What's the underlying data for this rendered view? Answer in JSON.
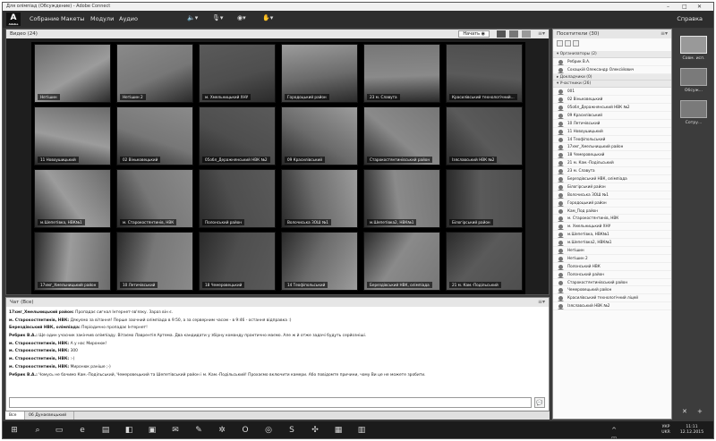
{
  "window": {
    "title": "Для олімпіад (Обсуждение) - Adobe Connect",
    "controls": [
      "–",
      "□",
      "✕"
    ]
  },
  "menubar": {
    "logo_text": "Adobe",
    "items": [
      "Собрание",
      "Макеты",
      "Модули",
      "Аудио"
    ],
    "help": "Справка"
  },
  "video_pod": {
    "title": "Видео (24)",
    "start_button": "Начать",
    "tiles": [
      "Нетішин",
      "Нетішин 2",
      "м. Хмельницький ХНУ",
      "Городоцький район",
      "23 м. Славута",
      "Красилівський технологічний...",
      "11 Новоушицький",
      "02 Віньковецький",
      "05обл_Деражнянський НВК №2",
      "09 Красилівський",
      "Старокостянтинівський район",
      "Ізяславський НВК №2",
      "м.Шепетівка, НВК№1",
      "м. Старокостянтинів, НВК",
      "Полонський район",
      "Волочиська ЗОШ №1",
      "м.Шепетівка2, НВК№1",
      "Білогірський район",
      "17хмг_Хмельницький район",
      "10 Летичівський",
      "18 Чемеровецький",
      "14 Теофіпольський",
      "Берездівський НВК, олімпіада",
      "21 м. Кам.-Подільський"
    ]
  },
  "chat": {
    "title": "Чат  (Все)",
    "messages": [
      {
        "sender": "17хмг_Хмельницький район:",
        "text": "Пропадає сигнал Інтернет-зв'язку. Зараз він є."
      },
      {
        "sender": "м. Старокостянтинів, НВК:",
        "text": "Дякуємо за вітання! Перше заочний олімпіада в 9:50, а за серверним часом - в 9:46 - остання відправка :)"
      },
      {
        "sender": "Берездівський НВК, олімпіада:",
        "text": "Періодично пропадає Інтернет!"
      },
      {
        "sender": "Ребрик В.А.:",
        "text": "Ще один учасник закінчив олімпіаду. Вітаємо Лаврентія Артема. Два кандидати у збірну команду практично маємо. Але ж й отже задачі будуть серйозніші."
      },
      {
        "sender": "м. Старокостянтинів, НВК:",
        "text": "А у нас Миронюк!"
      },
      {
        "sender": "м. Старокостянтинів, НВК:",
        "text": "300"
      },
      {
        "sender": "м. Старокостянтинів, НВК:",
        "text": ":-)"
      },
      {
        "sender": "м. Старокостянтинів, НВК:",
        "text": "Миронюк раніше ;-)"
      },
      {
        "sender": "Ребрик В.А.:",
        "text": "Чомусь не бачимо Кам.-Подільський, Чемеровецький та Шепетівський район і м. Кам.-Подільський! Прохаємо включити камери. Або повідомте причини, чому Ви це не можете зробити."
      }
    ],
    "tabs": [
      "Все",
      "06 Дунаєвецький"
    ]
  },
  "attendees": {
    "title": "Посетители  (30)",
    "groups": [
      {
        "name": "▾ Организаторы (2)",
        "members": [
          "Ребрик В.А.",
          "Сохацкій Олександр Олексійович"
        ]
      },
      {
        "name": "▸ Докладчики (0)",
        "members": []
      },
      {
        "name": "▾ Участники (26)",
        "members": [
          "001",
          "02 Віньковецький",
          "05обл_Деражнянський НВК №2",
          "09 Красилівський",
          "10 Летичівський",
          "11 Новоушицький",
          "14 Теофіпольський",
          "17хмг_Хмельницький район",
          "18 Чемеровецький",
          "21 м. Кам.-Подільський",
          "23 м. Славута",
          "Берездівський НВК, олімпіада",
          "Білогірський район",
          "Волочиська ЗОШ №1",
          "Городоцький район",
          "Кам_Под район",
          "м. Старокостянтинів, НВК",
          "м. Хмельницький ХНУ",
          "м.Шепетівка, НВК№1",
          "м.Шепетівка2, НВК№1",
          "Нетішин",
          "Нетішин 2",
          "Полонський НВК",
          "Полонський район",
          "Старокостянтинівський район",
          "Чемеровецький район",
          "Красилівський технологічний ліцей",
          "Ізяславський НВК №2"
        ]
      }
    ]
  },
  "rail": {
    "layouts": [
      "Совм. исп.",
      "Обсуж...",
      "Сотру..."
    ],
    "tools": [
      "✕",
      "+"
    ]
  },
  "taskbar": {
    "lang_top": "УКР",
    "lang_bottom": "UKR",
    "time": "11:11",
    "date": "12.12.2015"
  }
}
